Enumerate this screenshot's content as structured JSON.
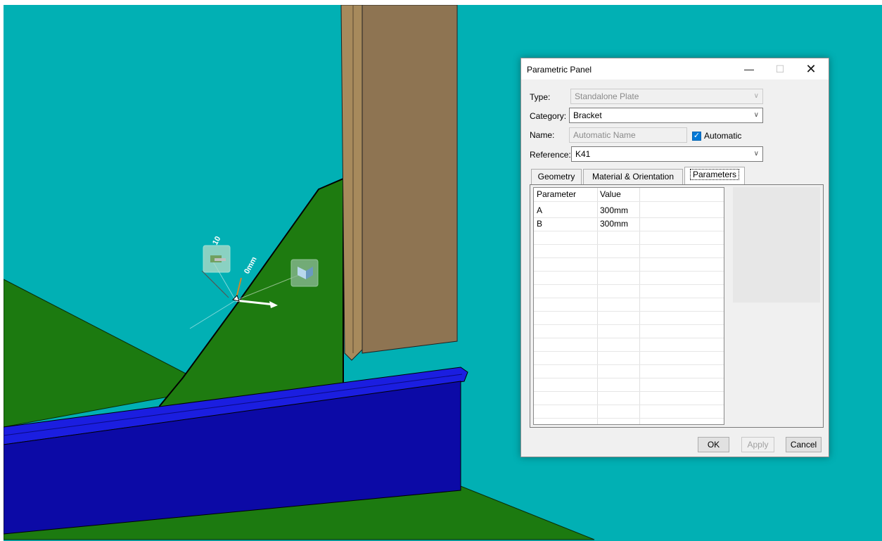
{
  "dialog": {
    "title": "Parametric Panel",
    "controls": {
      "minimize": "—",
      "maximize": "☐",
      "close": "✕"
    },
    "type": {
      "label": "Type:",
      "value": "Standalone Plate"
    },
    "category": {
      "label": "Category:",
      "value": "Bracket"
    },
    "name": {
      "label": "Name:",
      "value": "Automatic Name",
      "automatic_label": "Automatic",
      "automatic_checked": true
    },
    "reference": {
      "label": "Reference:",
      "value": "K41"
    },
    "tabs": [
      {
        "label": "Geometry"
      },
      {
        "label": "Material & Orientation"
      },
      {
        "label": "Parameters"
      }
    ],
    "grid": {
      "headers": [
        "Parameter",
        "Value"
      ],
      "rows": [
        [
          "A",
          "300mm"
        ],
        [
          "B",
          "300mm"
        ]
      ]
    },
    "buttons": {
      "ok": "OK",
      "apply": "Apply",
      "cancel": "Cancel"
    }
  },
  "viewport": {
    "background": "#01b0b4",
    "dim_labels": [
      "0mm",
      "10"
    ]
  }
}
